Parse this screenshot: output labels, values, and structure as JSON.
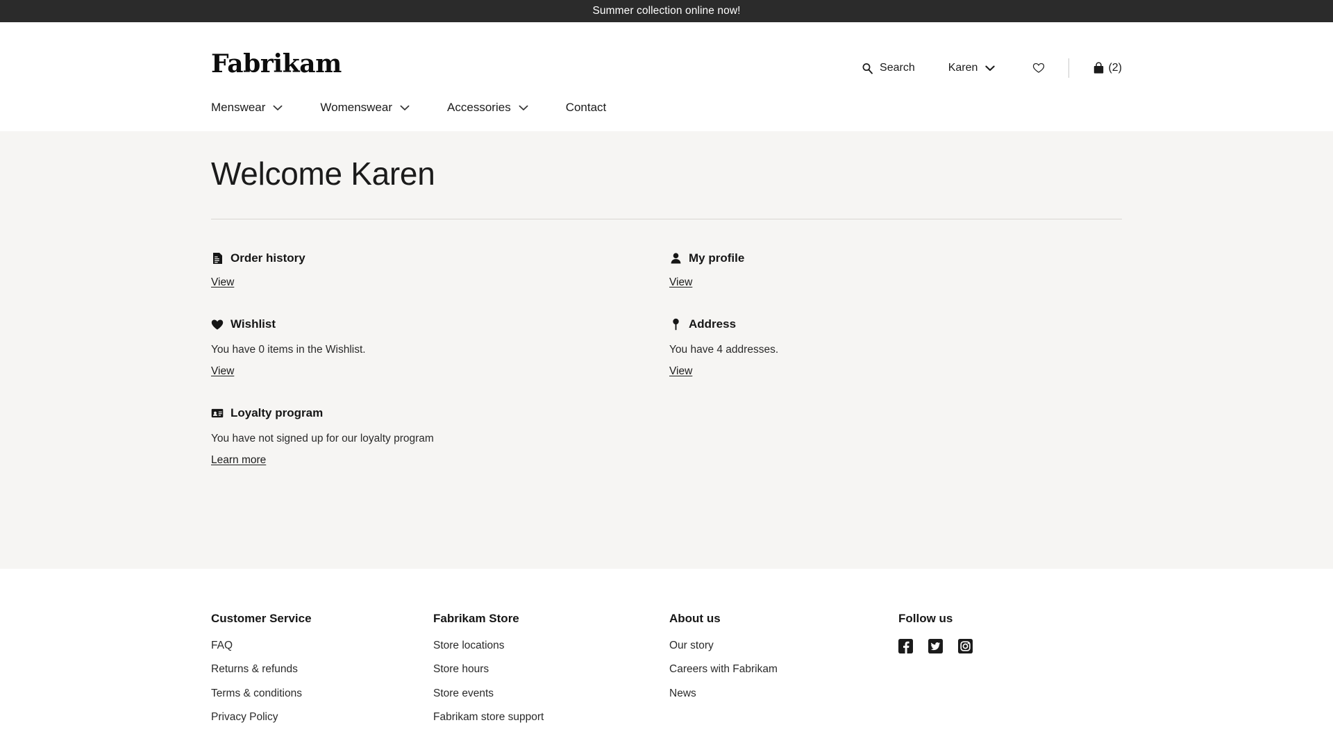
{
  "announcement": {
    "text": "Summer collection online now!"
  },
  "header": {
    "brand": "Fabrikam",
    "utils": {
      "search_label": "Search",
      "search_icon": "search-icon",
      "account_label": "Karen",
      "account_caret_icon": "chevron-down-icon",
      "wishlist_icon": "heart-outline-icon",
      "bag_icon": "shopping-bag-icon",
      "bag_count": "(2)"
    },
    "nav": [
      {
        "label": "Menswear",
        "has_caret": true,
        "caret_icon": "chevron-down-icon"
      },
      {
        "label": "Womenswear",
        "has_caret": true,
        "caret_icon": "chevron-down-icon"
      },
      {
        "label": "Accessories",
        "has_caret": true,
        "caret_icon": "chevron-down-icon"
      },
      {
        "label": "Contact",
        "has_caret": false,
        "caret_icon": ""
      }
    ]
  },
  "main": {
    "title": "Welcome Karen",
    "cards": [
      {
        "title": "Order history",
        "icon": "document-receipt-icon",
        "description": "",
        "link_label": "View"
      },
      {
        "title": "My profile",
        "icon": "person-icon",
        "description": "",
        "link_label": "View"
      },
      {
        "title": "Wishlist",
        "icon": "heart-filled-icon",
        "description": "You have 0 items in the Wishlist.",
        "link_label": "View"
      },
      {
        "title": "Address",
        "icon": "map-pin-icon",
        "description": "You have 4 addresses.",
        "link_label": "View"
      },
      {
        "title": "Loyalty program",
        "icon": "id-card-icon",
        "description": "You have not signed up for our loyalty program",
        "link_label": "Learn more"
      }
    ]
  },
  "footer": {
    "columns": [
      {
        "title": "Customer Service",
        "links": [
          "FAQ",
          "Returns & refunds",
          "Terms & conditions",
          "Privacy Policy"
        ]
      },
      {
        "title": "Fabrikam Store",
        "links": [
          "Store locations",
          "Store hours",
          "Store events",
          "Fabrikam store support"
        ]
      },
      {
        "title": "About us",
        "links": [
          "Our story",
          "Careers with Fabrikam",
          "News"
        ]
      }
    ],
    "follow": {
      "title": "Follow us",
      "icons": [
        "facebook-icon",
        "twitter-icon",
        "instagram-icon"
      ]
    }
  },
  "colors": {
    "announcement_bg": "#2b2b2b",
    "page_bg": "#f6f5f3",
    "footer_bg": "#ffffff",
    "text": "#1b1b1b",
    "rule": "#d8d6d2"
  }
}
